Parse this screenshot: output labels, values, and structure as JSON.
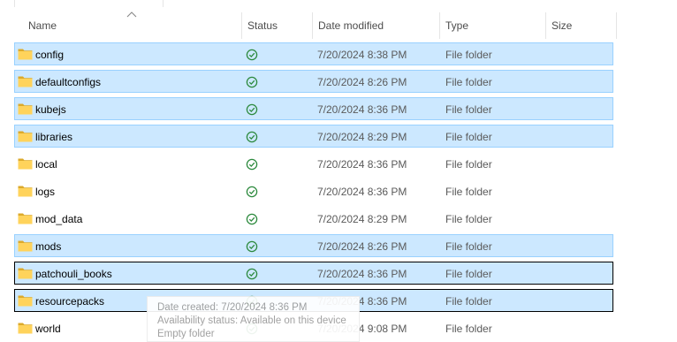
{
  "columns": {
    "name": "Name",
    "status": "Status",
    "date_modified": "Date modified",
    "type": "Type",
    "size": "Size"
  },
  "icons": {
    "folder": "folder-icon",
    "status": "sync-check-icon",
    "sort": "sort-up-icon"
  },
  "colors": {
    "folder_back": "#dcaa2b",
    "folder_front": "#ffd35b",
    "status_green": "#2d8a3e",
    "selection": "#cce8ff",
    "selection_border": "#99d1ff"
  },
  "files": [
    {
      "name": "config",
      "date": "7/20/2024 8:38 PM",
      "type": "File folder",
      "state": "selected"
    },
    {
      "name": "defaultconfigs",
      "date": "7/20/2024 8:26 PM",
      "type": "File folder",
      "state": "selected"
    },
    {
      "name": "kubejs",
      "date": "7/20/2024 8:36 PM",
      "type": "File folder",
      "state": "selected"
    },
    {
      "name": "libraries",
      "date": "7/20/2024 8:29 PM",
      "type": "File folder",
      "state": "selected"
    },
    {
      "name": "local",
      "date": "7/20/2024 8:36 PM",
      "type": "File folder",
      "state": "none"
    },
    {
      "name": "logs",
      "date": "7/20/2024 8:36 PM",
      "type": "File folder",
      "state": "none"
    },
    {
      "name": "mod_data",
      "date": "7/20/2024 8:29 PM",
      "type": "File folder",
      "state": "none"
    },
    {
      "name": "mods",
      "date": "7/20/2024 8:26 PM",
      "type": "File folder",
      "state": "selected"
    },
    {
      "name": "patchouli_books",
      "date": "7/20/2024 8:36 PM",
      "type": "File folder",
      "state": "focused"
    },
    {
      "name": "resourcepacks",
      "date": "7/20/2024 8:36 PM",
      "type": "File folder",
      "state": "focused"
    },
    {
      "name": "world",
      "date": "7/20/2024 9:08 PM",
      "type": "File folder",
      "state": "none"
    }
  ],
  "tooltip": {
    "line1": "Date created: 7/20/2024 8:36 PM",
    "line2": "Availability status: Available on this device",
    "line3": "Empty folder"
  }
}
